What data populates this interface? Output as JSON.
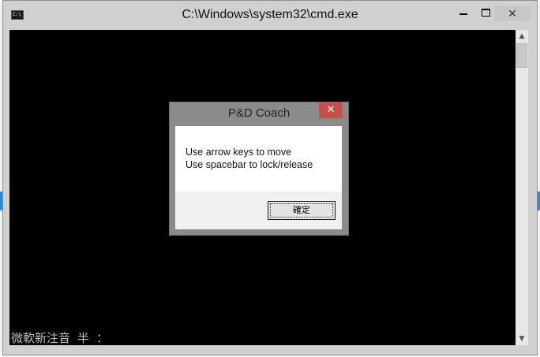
{
  "window": {
    "title": "C:\\Windows\\system32\\cmd.exe",
    "icon": "console-icon",
    "icon_text": "C:\\",
    "buttons": {
      "minimize": "minimize-icon",
      "maximize": "maximize-icon",
      "close": "close-icon"
    }
  },
  "console": {
    "background": "#000000",
    "status_text": "微軟新注音 半 ："
  },
  "dialog": {
    "title": "P&D Coach",
    "close_symbol": "✕",
    "message_lines": [
      "Use arrow keys to move",
      "Use spacebar to lock/release"
    ],
    "ok_label": "確定",
    "close_color": "#c9504a"
  },
  "scrollbar": {
    "up_arrow": "▲",
    "down_arrow": "▼"
  }
}
